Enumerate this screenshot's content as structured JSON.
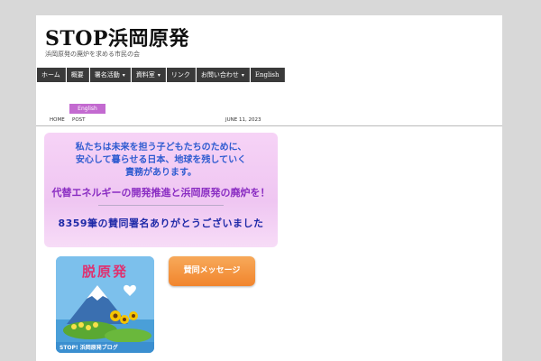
{
  "site": {
    "title": "STOP浜岡原発",
    "description": "浜岡原発の廃炉を求める市民の会"
  },
  "nav": {
    "items": [
      {
        "label": "ホーム",
        "has_dropdown": false
      },
      {
        "label": "概要",
        "has_dropdown": false
      },
      {
        "label": "署名活動",
        "has_dropdown": true
      },
      {
        "label": "資料室",
        "has_dropdown": true
      },
      {
        "label": "リンク",
        "has_dropdown": false
      },
      {
        "label": "お問い合わせ",
        "has_dropdown": true
      },
      {
        "label": "English",
        "has_dropdown": false
      }
    ],
    "caret": "▾"
  },
  "lang_button": "English",
  "breadcrumb": {
    "home": "HOME",
    "post": "POST",
    "date": "JUNE 11, 2023"
  },
  "banner": {
    "line1": "私たちは未来を担う子どもたちのために、",
    "line2": "安心して暮らせる日本、地球を残していく",
    "line3": "責務があります。",
    "line4": "代替エネルギーの開発推進と浜岡原発の廃炉を！",
    "line5": "8359筆の賛同署名ありがとうございました"
  },
  "logo": {
    "heading": "脱原発",
    "caption": "STOP! 浜岡原発ブログ"
  },
  "message_button": "賛同メッセージ",
  "colors": {
    "nav_bg": "#3a3a3a",
    "lang_button": "#c36ad0",
    "message_button": "#f1852d",
    "banner_bg": "#f6d3f6"
  }
}
